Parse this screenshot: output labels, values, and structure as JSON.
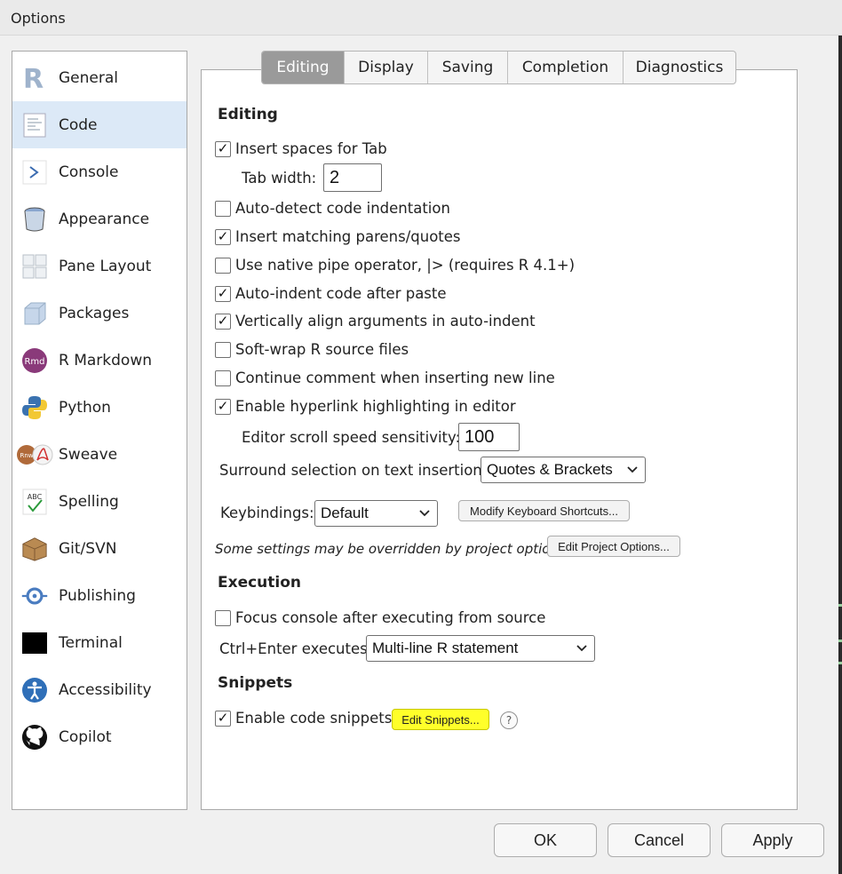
{
  "window": {
    "title": "Options"
  },
  "sidebar": {
    "items": [
      {
        "label": "General",
        "icon": "r-logo-icon"
      },
      {
        "label": "Code",
        "icon": "code-document-icon",
        "selected": true
      },
      {
        "label": "Console",
        "icon": "console-prompt-icon"
      },
      {
        "label": "Appearance",
        "icon": "paint-bucket-icon"
      },
      {
        "label": "Pane Layout",
        "icon": "pane-layout-icon"
      },
      {
        "label": "Packages",
        "icon": "package-cube-icon"
      },
      {
        "label": "R Markdown",
        "icon": "rmd-icon"
      },
      {
        "label": "Python",
        "icon": "python-icon"
      },
      {
        "label": "Sweave",
        "icon": "sweave-icon"
      },
      {
        "label": "Spelling",
        "icon": "spelling-icon"
      },
      {
        "label": "Git/SVN",
        "icon": "git-box-icon"
      },
      {
        "label": "Publishing",
        "icon": "publishing-icon"
      },
      {
        "label": "Terminal",
        "icon": "terminal-icon"
      },
      {
        "label": "Accessibility",
        "icon": "accessibility-icon"
      },
      {
        "label": "Copilot",
        "icon": "github-icon"
      }
    ],
    "icon_labels": {
      "rmd": "Rmd",
      "sweave": "Rnw",
      "spelling": "ABC"
    }
  },
  "tabs": [
    {
      "label": "Editing",
      "active": true
    },
    {
      "label": "Display"
    },
    {
      "label": "Saving"
    },
    {
      "label": "Completion"
    },
    {
      "label": "Diagnostics"
    }
  ],
  "editing": {
    "title": "Editing",
    "insert_spaces": {
      "label": "Insert spaces for Tab",
      "checked": true
    },
    "tab_width": {
      "label": "Tab width:",
      "value": "2"
    },
    "auto_detect": {
      "label": "Auto-detect code indentation",
      "checked": false
    },
    "matching_parens": {
      "label": "Insert matching parens/quotes",
      "checked": true
    },
    "native_pipe": {
      "label": "Use native pipe operator, |> (requires R 4.1+)",
      "checked": false
    },
    "auto_indent_paste": {
      "label": "Auto-indent code after paste",
      "checked": true
    },
    "vertical_align": {
      "label": "Vertically align arguments in auto-indent",
      "checked": true
    },
    "soft_wrap": {
      "label": "Soft-wrap R source files",
      "checked": false
    },
    "continue_comment": {
      "label": "Continue comment when inserting new line",
      "checked": false
    },
    "hyperlink": {
      "label": "Enable hyperlink highlighting in editor",
      "checked": true
    },
    "scroll_speed": {
      "label": "Editor scroll speed sensitivity:",
      "value": "100"
    },
    "surround": {
      "label": "Surround selection on text insertion:",
      "value": "Quotes & Brackets"
    },
    "keybindings": {
      "label": "Keybindings:",
      "value": "Default",
      "modify_button": "Modify Keyboard Shortcuts..."
    },
    "project_note": "Some settings may be overridden by project options.",
    "edit_project_button": "Edit Project Options..."
  },
  "execution": {
    "title": "Execution",
    "focus_console": {
      "label": "Focus console after executing from source",
      "checked": false
    },
    "ctrl_enter": {
      "label": "Ctrl+Enter executes:",
      "value": "Multi-line R statement"
    }
  },
  "snippets": {
    "title": "Snippets",
    "enable": {
      "label": "Enable code snippets",
      "checked": true
    },
    "edit_button": "Edit Snippets...",
    "help": "?"
  },
  "footer": {
    "ok": "OK",
    "cancel": "Cancel",
    "apply": "Apply"
  },
  "check_glyph": "✓",
  "colors": {
    "selected_item": "#dce9f7",
    "active_tab": "#9a9a9a",
    "highlight": "#ffff2a"
  }
}
